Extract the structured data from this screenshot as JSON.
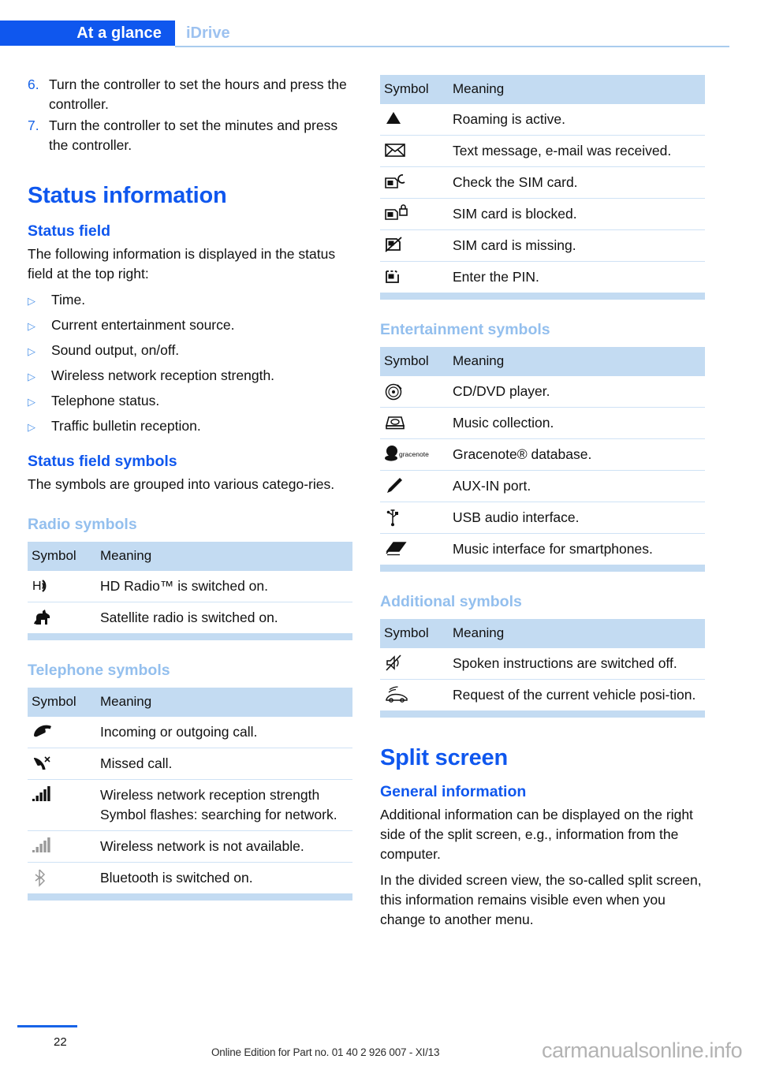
{
  "header": {
    "active_tab": "At a glance",
    "inactive_tab": "iDrive",
    "accent_color": "#0F57EE",
    "muted_color": "#93BFEE",
    "table_header_bg": "#C3DBF2"
  },
  "left_column": {
    "steps": [
      {
        "num": "6.",
        "text": "Turn the controller to set the hours and press the controller."
      },
      {
        "num": "7.",
        "text": "Turn the controller to set the minutes and press the controller."
      }
    ],
    "status_information_heading": "Status information",
    "status_field_heading": "Status field",
    "status_field_intro": "The following information is displayed in the status field at the top right:",
    "status_field_items": [
      "Time.",
      "Current entertainment source.",
      "Sound output, on/off.",
      "Wireless network reception strength.",
      "Telephone status.",
      "Traffic bulletin reception."
    ],
    "status_field_symbols_heading": "Status field symbols",
    "status_field_symbols_intro": "The symbols are grouped into various catego-ries.",
    "radio_symbols_heading": "Radio symbols",
    "radio_table": {
      "columns": [
        "Symbol",
        "Meaning"
      ],
      "rows": [
        {
          "icon": "hd-radio-icon",
          "meaning": "HD Radio™ is switched on."
        },
        {
          "icon": "satellite-radio-dog-icon",
          "meaning": "Satellite radio is switched on."
        }
      ]
    },
    "telephone_symbols_heading": "Telephone symbols",
    "telephone_table": {
      "columns": [
        "Symbol",
        "Meaning"
      ],
      "rows": [
        {
          "icon": "phone-handset-icon",
          "meaning": "Incoming or outgoing call."
        },
        {
          "icon": "missed-call-icon",
          "meaning": "Missed call."
        },
        {
          "icon": "signal-bars-icon",
          "meaning": "Wireless network reception strength Symbol flashes: searching for network."
        },
        {
          "icon": "signal-bars-gray-icon",
          "meaning": "Wireless network is not available."
        },
        {
          "icon": "bluetooth-icon",
          "meaning": "Bluetooth is switched on."
        }
      ]
    }
  },
  "right_column": {
    "status_table_continued": {
      "columns": [
        "Symbol",
        "Meaning"
      ],
      "rows": [
        {
          "icon": "roaming-triangle-icon",
          "meaning": "Roaming is active."
        },
        {
          "icon": "envelope-icon",
          "meaning": "Text message, e-mail was received."
        },
        {
          "icon": "sim-check-icon",
          "meaning": "Check the SIM card."
        },
        {
          "icon": "sim-blocked-icon",
          "meaning": "SIM card is blocked."
        },
        {
          "icon": "sim-missing-icon",
          "meaning": "SIM card is missing."
        },
        {
          "icon": "sim-pin-icon",
          "meaning": "Enter the PIN."
        }
      ]
    },
    "entertainment_symbols_heading": "Entertainment symbols",
    "entertainment_table": {
      "columns": [
        "Symbol",
        "Meaning"
      ],
      "rows": [
        {
          "icon": "cd-dvd-disc-icon",
          "meaning": "CD/DVD player."
        },
        {
          "icon": "music-collection-icon",
          "meaning": "Music collection."
        },
        {
          "icon": "gracenote-logo-icon",
          "meaning": "Gracenote® database."
        },
        {
          "icon": "aux-in-plug-icon",
          "meaning": "AUX-IN port."
        },
        {
          "icon": "usb-icon",
          "meaning": "USB audio interface."
        },
        {
          "icon": "smartphone-music-interface-icon",
          "meaning": "Music interface for smartphones."
        }
      ]
    },
    "additional_symbols_heading": "Additional symbols",
    "additional_table": {
      "columns": [
        "Symbol",
        "Meaning"
      ],
      "rows": [
        {
          "icon": "speaker-muted-icon",
          "meaning": "Spoken instructions are switched off."
        },
        {
          "icon": "vehicle-position-icon",
          "meaning": "Request of the current vehicle posi-tion."
        }
      ]
    },
    "split_screen_heading": "Split screen",
    "general_information_heading": "General information",
    "split_screen_p1": "Additional information can be displayed on the right side of the split screen, e.g., information from the computer.",
    "split_screen_p2": "In the divided screen view, the so-called split screen, this information remains visible even when you change to another menu."
  },
  "footer": {
    "page_number": "22",
    "edition_text": "Online Edition for Part no. 01 40 2 926 007 - XI/13",
    "watermark": "carmanualsonline.info"
  }
}
